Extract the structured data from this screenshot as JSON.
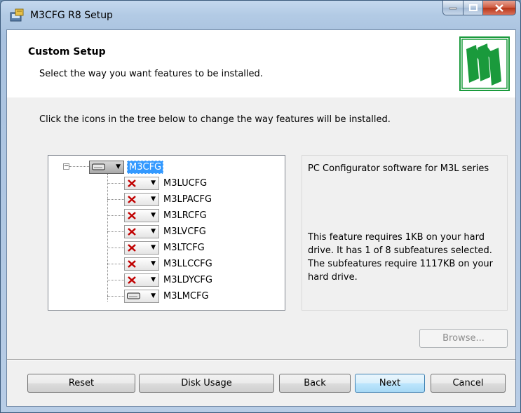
{
  "window": {
    "title": "M3CFG R8 Setup"
  },
  "banner": {
    "title": "Custom Setup",
    "subtitle": "Select the way you want features to be installed."
  },
  "instructions": "Click the icons in the tree below to change the way features will be installed.",
  "tree": {
    "root": {
      "label": "M3CFG",
      "state": "install-local",
      "expanded": true,
      "selected": true
    },
    "children": [
      {
        "label": "M3LUCFG",
        "state": "unavailable"
      },
      {
        "label": "M3LPACFG",
        "state": "unavailable"
      },
      {
        "label": "M3LRCFG",
        "state": "unavailable"
      },
      {
        "label": "M3LVCFG",
        "state": "unavailable"
      },
      {
        "label": "M3LTCFG",
        "state": "unavailable"
      },
      {
        "label": "M3LLCCFG",
        "state": "unavailable"
      },
      {
        "label": "M3LDYCFG",
        "state": "unavailable"
      },
      {
        "label": "M3LMCFG",
        "state": "install-local"
      }
    ]
  },
  "description": {
    "text": "PC Configurator software for M3L series",
    "size_info": "This feature requires 1KB on your hard drive. It has 1 of 8 subfeatures selected. The subfeatures require 1117KB on your hard drive."
  },
  "buttons": {
    "browse": "Browse...",
    "reset": "Reset",
    "disk_usage": "Disk Usage",
    "back": "Back",
    "next": "Next",
    "cancel": "Cancel"
  },
  "colors": {
    "accent_green": "#1a9a3c",
    "selection_blue": "#3399ff",
    "unavailable_red": "#c00000"
  }
}
